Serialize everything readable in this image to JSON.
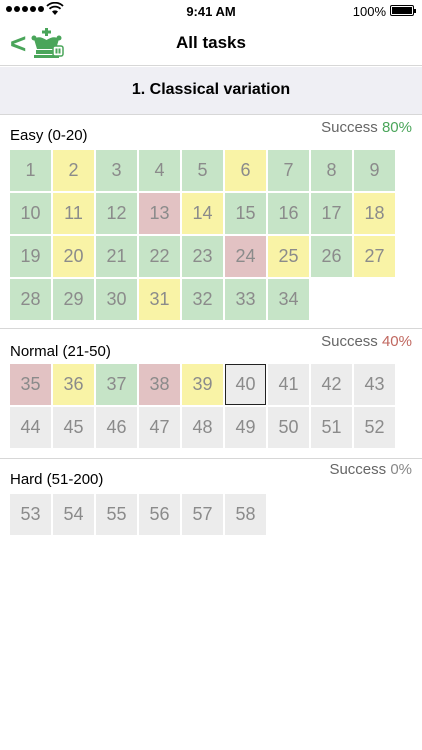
{
  "status_bar": {
    "time": "9:41 AM",
    "battery": "100%"
  },
  "nav": {
    "title": "All tasks",
    "back_glyph": "<"
  },
  "section": {
    "title": "1. Classical variation"
  },
  "colors": {
    "green": "#c6e4c7",
    "yellow": "#f9f3a6",
    "red": "#e2c2c3",
    "gray": "#ececec",
    "success_green": "#4aa55a",
    "success_red": "#c0675f"
  },
  "groups": [
    {
      "label": "Easy (0-20)",
      "success_label": "Success",
      "success_value": "80%",
      "success_color": "#4aa55a",
      "tiles": [
        {
          "n": "1",
          "s": "green"
        },
        {
          "n": "2",
          "s": "yellow"
        },
        {
          "n": "3",
          "s": "green"
        },
        {
          "n": "4",
          "s": "green"
        },
        {
          "n": "5",
          "s": "green"
        },
        {
          "n": "6",
          "s": "yellow"
        },
        {
          "n": "7",
          "s": "green"
        },
        {
          "n": "8",
          "s": "green"
        },
        {
          "n": "9",
          "s": "green"
        },
        {
          "n": "10",
          "s": "green"
        },
        {
          "n": "11",
          "s": "yellow"
        },
        {
          "n": "12",
          "s": "green"
        },
        {
          "n": "13",
          "s": "red"
        },
        {
          "n": "14",
          "s": "yellow"
        },
        {
          "n": "15",
          "s": "green"
        },
        {
          "n": "16",
          "s": "green"
        },
        {
          "n": "17",
          "s": "green"
        },
        {
          "n": "18",
          "s": "yellow"
        },
        {
          "n": "19",
          "s": "green"
        },
        {
          "n": "20",
          "s": "yellow"
        },
        {
          "n": "21",
          "s": "green"
        },
        {
          "n": "22",
          "s": "green"
        },
        {
          "n": "23",
          "s": "green"
        },
        {
          "n": "24",
          "s": "red"
        },
        {
          "n": "25",
          "s": "yellow"
        },
        {
          "n": "26",
          "s": "green"
        },
        {
          "n": "27",
          "s": "yellow"
        },
        {
          "n": "28",
          "s": "green"
        },
        {
          "n": "29",
          "s": "green"
        },
        {
          "n": "30",
          "s": "green"
        },
        {
          "n": "31",
          "s": "yellow"
        },
        {
          "n": "32",
          "s": "green"
        },
        {
          "n": "33",
          "s": "green"
        },
        {
          "n": "34",
          "s": "green"
        }
      ]
    },
    {
      "label": "Normal (21-50)",
      "success_label": "Success",
      "success_value": "40%",
      "success_color": "#c0675f",
      "tiles": [
        {
          "n": "35",
          "s": "red"
        },
        {
          "n": "36",
          "s": "yellow"
        },
        {
          "n": "37",
          "s": "green"
        },
        {
          "n": "38",
          "s": "red"
        },
        {
          "n": "39",
          "s": "yellow"
        },
        {
          "n": "40",
          "s": "current"
        },
        {
          "n": "41",
          "s": "gray"
        },
        {
          "n": "42",
          "s": "gray"
        },
        {
          "n": "43",
          "s": "gray"
        },
        {
          "n": "44",
          "s": "gray"
        },
        {
          "n": "45",
          "s": "gray"
        },
        {
          "n": "46",
          "s": "gray"
        },
        {
          "n": "47",
          "s": "gray"
        },
        {
          "n": "48",
          "s": "gray"
        },
        {
          "n": "49",
          "s": "gray"
        },
        {
          "n": "50",
          "s": "gray"
        },
        {
          "n": "51",
          "s": "gray"
        },
        {
          "n": "52",
          "s": "gray"
        }
      ]
    },
    {
      "label": "Hard (51-200)",
      "success_label": "Success",
      "success_value": "0%",
      "success_color": "#888888",
      "tiles": [
        {
          "n": "53",
          "s": "gray"
        },
        {
          "n": "54",
          "s": "gray"
        },
        {
          "n": "55",
          "s": "gray"
        },
        {
          "n": "56",
          "s": "gray"
        },
        {
          "n": "57",
          "s": "gray"
        },
        {
          "n": "58",
          "s": "gray"
        }
      ]
    }
  ]
}
